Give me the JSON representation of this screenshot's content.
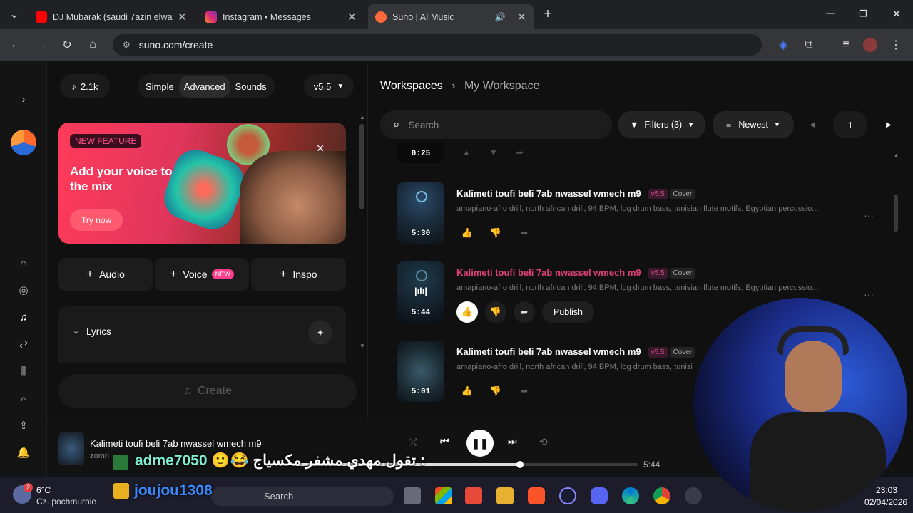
{
  "browser": {
    "tabs": [
      {
        "title": "DJ Mubarak (saudi 7azin elwat",
        "favicon": "youtube-icon",
        "color": "#ff0000"
      },
      {
        "title": "Instagram • Messages",
        "favicon": "instagram-icon",
        "color": "#d6249f"
      },
      {
        "title": "Suno | AI Music",
        "favicon": "suno-icon",
        "color": "#ff6a3d",
        "active": true
      }
    ],
    "url": "suno.com/create"
  },
  "create": {
    "song_count": "2.1k",
    "modes": [
      "Simple",
      "Advanced",
      "Sounds"
    ],
    "active_mode": "Advanced",
    "version": "v5.5",
    "banner": {
      "badge": "NEW FEATURE",
      "headline": "Add your voice to the mix",
      "cta": "Try now"
    },
    "add_buttons": [
      {
        "label": "Audio"
      },
      {
        "label": "Voice",
        "badge": "NEW"
      },
      {
        "label": "Inspo"
      }
    ],
    "lyrics_label": "Lyrics",
    "create_label": "Create"
  },
  "workspace": {
    "breadcrumb_root": "Workspaces",
    "breadcrumb_current": "My Workspace",
    "search_placeholder": "Search",
    "filters_label": "Filters (3)",
    "sort_label": "Newest",
    "page": "1",
    "partial_duration": "0:25",
    "songs": [
      {
        "title": "Kalimeti toufi beli 7ab nwassel wmech m9",
        "version": "v5.5",
        "tag": "Cover",
        "desc": "amapiano-afro drill, north african drill, 94 BPM, log drum bass, tunisian flute motifs, Egyptian percussio...",
        "duration": "5:30",
        "playing": false
      },
      {
        "title": "Kalimeti toufi beli 7ab nwassel wmech m9",
        "version": "v5.5",
        "tag": "Cover",
        "desc": "amapiano-afro drill, north african drill, 94 BPM, log drum bass, tunisian flute motifs, Egyptian percussio...",
        "duration": "5:44",
        "playing": true,
        "publish": "Publish"
      },
      {
        "title": "Kalimeti toufi beli 7ab nwassel wmech m9",
        "version": "v5.5",
        "tag": "Cover",
        "desc": "amapiano-afro drill, north african drill, 94 BPM, log drum bass, tunisi",
        "duration": "5:01",
        "playing": false
      }
    ]
  },
  "player": {
    "title": "Kalimeti toufi beli 7ab nwassel wmech m9",
    "artist": "zomri",
    "duration": "5:44",
    "progress": 0.66
  },
  "overlay": {
    "chat_user": "adme7050",
    "chat_text": ": تقول مهدي مشفر مكسياج 😂🙂",
    "chat_user2": "joujou1308"
  },
  "taskbar": {
    "weather_temp": "6°C",
    "weather_desc": "Cz. pochmurnie",
    "weather_badge": "2",
    "search_placeholder": "Search",
    "time": "23:03",
    "date": "02/04/2026"
  }
}
